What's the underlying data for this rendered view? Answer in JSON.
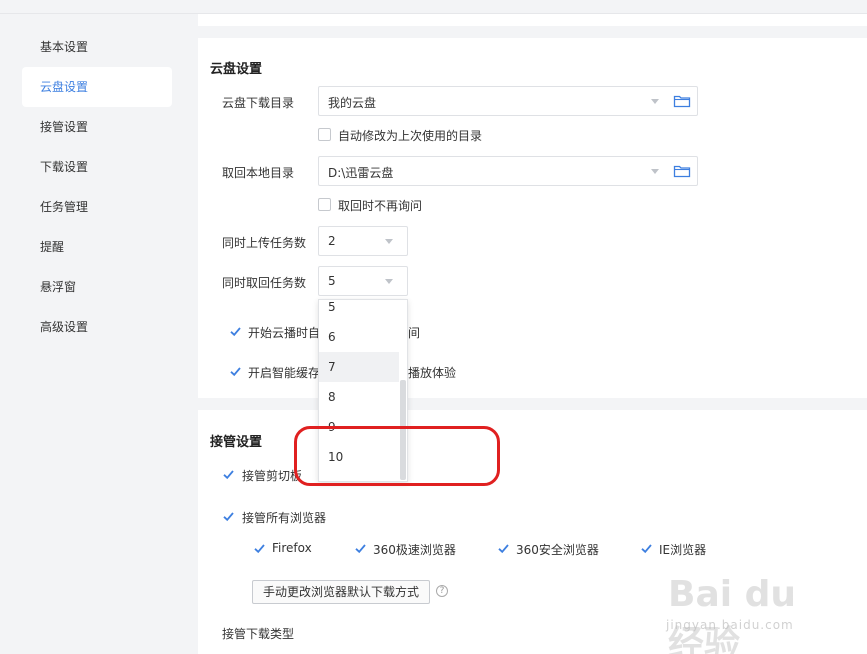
{
  "sidebar": {
    "items": [
      {
        "label": "基本设置",
        "active": false
      },
      {
        "label": "云盘设置",
        "active": true
      },
      {
        "label": "接管设置",
        "active": false
      },
      {
        "label": "下载设置",
        "active": false
      },
      {
        "label": "任务管理",
        "active": false
      },
      {
        "label": "提醒",
        "active": false
      },
      {
        "label": "悬浮窗",
        "active": false
      },
      {
        "label": "高级设置",
        "active": false
      }
    ]
  },
  "cloud": {
    "title": "云盘设置",
    "download_dir_label": "云盘下载目录",
    "download_dir_value": "我的云盘",
    "auto_modify_label": "自动修改为上次使用的目录",
    "auto_modify_checked": false,
    "retrieve_dir_label": "取回本地目录",
    "retrieve_dir_value": "D:\\迅雷云盘",
    "no_ask_label": "取回时不再询问",
    "no_ask_checked": false,
    "upload_count_label": "同时上传任务数",
    "upload_count_value": "2",
    "retrieve_count_label": "同时取回任务数",
    "retrieve_count_value": "5",
    "option1_prefix": "开始云播时自",
    "option1_suffix": "间",
    "option1_checked": true,
    "option2_prefix": "开启智能缓存",
    "option2_suffix": "播放体验",
    "option2_checked": true
  },
  "dropdown": {
    "options": [
      "5",
      "6",
      "7",
      "8",
      "9",
      "10"
    ],
    "hovered": "7"
  },
  "takeover": {
    "title": "接管设置",
    "clipboard_label": "接管剪切板",
    "clipboard_checked": true,
    "all_browsers_label": "接管所有浏览器",
    "all_browsers_checked": true,
    "browsers": [
      {
        "label": "Firefox",
        "checked": true
      },
      {
        "label": "360极速浏览器",
        "checked": true
      },
      {
        "label": "360安全浏览器",
        "checked": true
      },
      {
        "label": "IE浏览器",
        "checked": true
      }
    ],
    "manual_button": "手动更改浏览器默认下载方式",
    "help_glyph": "?",
    "download_type_label": "接管下载类型"
  },
  "watermark": {
    "logo": "Bai du 经验",
    "sub": "jingyan.baidu.com"
  },
  "colors": {
    "accent": "#3d7fe0",
    "annotation": "#e02020"
  }
}
